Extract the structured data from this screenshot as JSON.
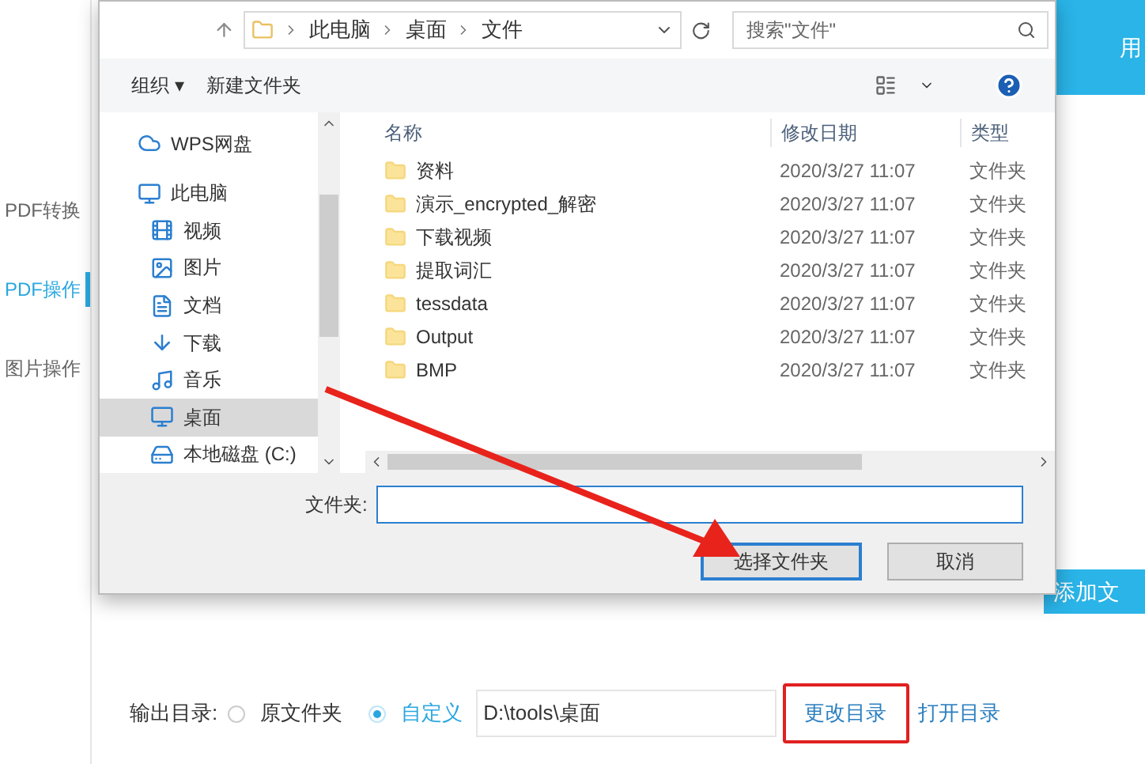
{
  "app": {
    "sidebar": [
      {
        "label": "PDF转换",
        "selected": false
      },
      {
        "label": "PDF操作",
        "selected": true
      },
      {
        "label": "图片操作",
        "selected": false
      }
    ],
    "header_text": "用",
    "add_button": "添加文",
    "output": {
      "label": "输出目录:",
      "options": [
        {
          "label": "原文件夹",
          "selected": false
        },
        {
          "label": "自定义",
          "selected": true
        }
      ],
      "path": "D:\\tools\\桌面",
      "change_link": "更改目录",
      "open_link": "打开目录"
    }
  },
  "dialog": {
    "breadcrumb": [
      "此电脑",
      "桌面",
      "文件"
    ],
    "search": {
      "placeholder": "搜索\"文件\""
    },
    "toolbar": {
      "organize": "组织 ▾",
      "new_folder": "新建文件夹"
    },
    "nav": [
      {
        "label": "WPS网盘",
        "kind": "cloud",
        "selected": false
      },
      {
        "label": "此电脑",
        "kind": "computer",
        "selected": false
      },
      {
        "label": "视频",
        "kind": "video",
        "selected": false
      },
      {
        "label": "图片",
        "kind": "picture",
        "selected": false
      },
      {
        "label": "文档",
        "kind": "document",
        "selected": false
      },
      {
        "label": "下载",
        "kind": "download",
        "selected": false
      },
      {
        "label": "音乐",
        "kind": "music",
        "selected": false
      },
      {
        "label": "桌面",
        "kind": "desktop",
        "selected": true
      },
      {
        "label": "本地磁盘 (C:)",
        "kind": "disk",
        "selected": false
      }
    ],
    "columns": [
      "名称",
      "修改日期",
      "类型"
    ],
    "rows": [
      {
        "name": "资料",
        "date": "2020/3/27 11:07",
        "type": "文件夹"
      },
      {
        "name": "演示_encrypted_解密",
        "date": "2020/3/27 11:07",
        "type": "文件夹"
      },
      {
        "name": "下载视频",
        "date": "2020/3/27 11:07",
        "type": "文件夹"
      },
      {
        "name": "提取词汇",
        "date": "2020/3/27 11:07",
        "type": "文件夹"
      },
      {
        "name": "tessdata",
        "date": "2020/3/27 11:07",
        "type": "文件夹"
      },
      {
        "name": "Output",
        "date": "2020/3/27 11:07",
        "type": "文件夹"
      },
      {
        "name": "BMP",
        "date": "2020/3/27 11:07",
        "type": "文件夹"
      }
    ],
    "folder_label": "文件夹:",
    "ok": "选择文件夹",
    "cancel": "取消"
  }
}
